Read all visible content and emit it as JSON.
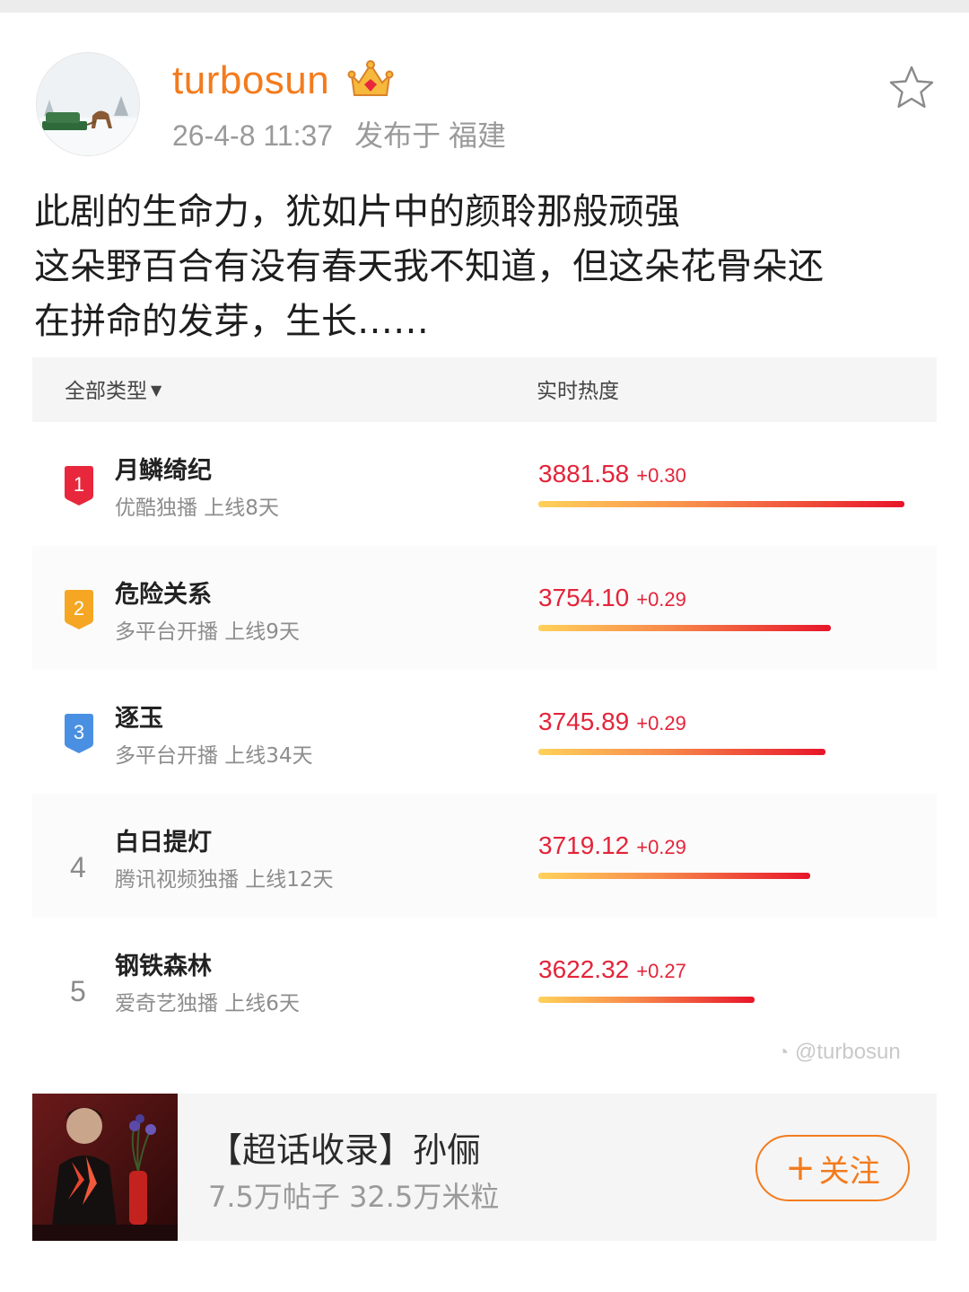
{
  "post": {
    "username": "turbosun",
    "timestamp": "26-4-8 11:37",
    "location": "发布于 福建",
    "lines": [
      "此剧的生命力，犹如片中的颜聆那般顽强",
      "这朵野百合有没有春天我不知道，但这朵花骨朵还",
      "在拼命的发芽，生长……"
    ]
  },
  "ranking": {
    "filter_label": "全部类型",
    "column_title": "实时热度",
    "rows": [
      {
        "rank": "1",
        "name": "月鳞绮纪",
        "sub": "优酷独播 上线8天",
        "score": "3881.58",
        "delta": "+0.30",
        "heat": 3881.58
      },
      {
        "rank": "2",
        "name": "危险关系",
        "sub": "多平台开播 上线9天",
        "score": "3754.10",
        "delta": "+0.29",
        "heat": 3754.1
      },
      {
        "rank": "3",
        "name": "逐玉",
        "sub": "多平台开播 上线34天",
        "score": "3745.89",
        "delta": "+0.29",
        "heat": 3745.89
      },
      {
        "rank": "4",
        "name": "白日提灯",
        "sub": "腾讯视频独播 上线12天",
        "score": "3719.12",
        "delta": "+0.29",
        "heat": 3719.12
      },
      {
        "rank": "5",
        "name": "钢铁森林",
        "sub": "爱奇艺独播 上线6天",
        "score": "3622.32",
        "delta": "+0.27",
        "heat": 3622.32
      }
    ],
    "watermark": "@turbosun"
  },
  "topic": {
    "title": "【超话收录】孙俪",
    "stats": "7.5万帖子 32.5万米粒",
    "follow_label": "关注",
    "follow_plus": "+"
  },
  "colors": {
    "accent": "#f37b1d",
    "score_red": "#e3243a",
    "rank1": "#e8273c",
    "rank2": "#f5a623",
    "rank3": "#4a90e2"
  },
  "icons": {
    "favorite": "star-outline-icon",
    "vip": "crown-icon",
    "filter": "caret-down-icon"
  }
}
